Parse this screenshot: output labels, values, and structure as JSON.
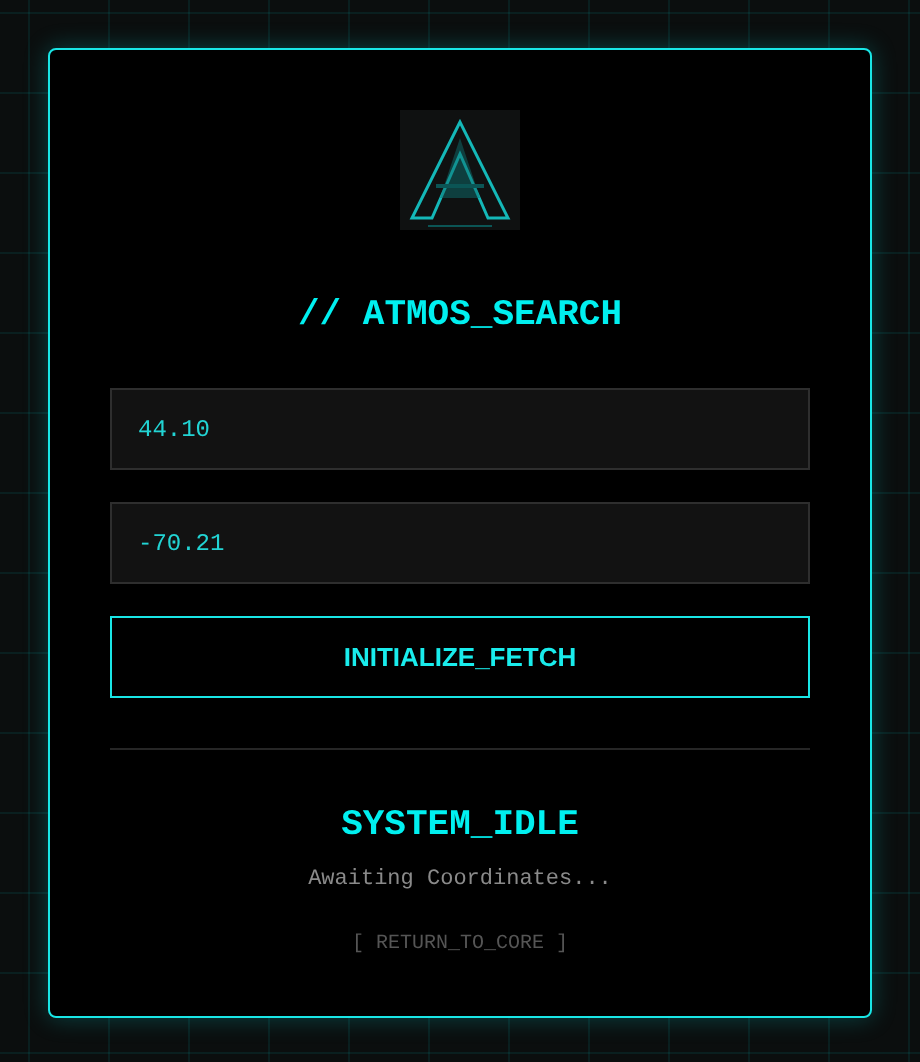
{
  "title": "// ATMOS_SEARCH",
  "fields": [
    {
      "value": "44.10"
    },
    {
      "value": "-70.21"
    }
  ],
  "fetch_button": "INITIALIZE_FETCH",
  "status": {
    "heading": "SYSTEM_IDLE",
    "message": "Awaiting Coordinates..."
  },
  "return_link": "[ RETURN_TO_CORE ]"
}
